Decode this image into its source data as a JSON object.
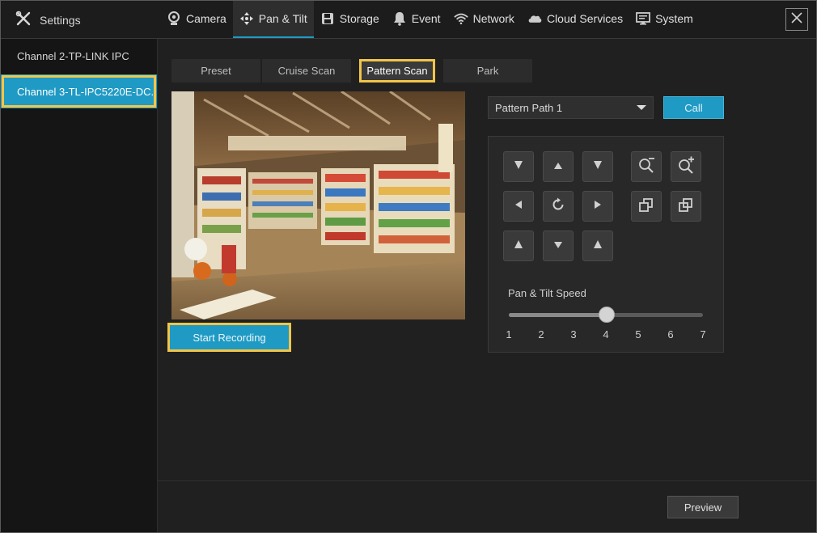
{
  "app": {
    "title": "Settings",
    "icon": "tools-icon"
  },
  "nav": [
    {
      "label": "Camera",
      "icon": "camera-icon",
      "active": false
    },
    {
      "label": "Pan & Tilt",
      "icon": "pan-tilt-icon",
      "active": true
    },
    {
      "label": "Storage",
      "icon": "storage-icon",
      "active": false
    },
    {
      "label": "Event",
      "icon": "bell-icon",
      "active": false
    },
    {
      "label": "Network",
      "icon": "wifi-icon",
      "active": false
    },
    {
      "label": "Cloud Services",
      "icon": "cloud-icon",
      "active": false
    },
    {
      "label": "System",
      "icon": "monitor-icon",
      "active": false
    }
  ],
  "sidebar": {
    "items": [
      {
        "label": "Channel 2-TP-LINK IPC",
        "active": false
      },
      {
        "label": "Channel 3-TL-IPC5220E-DC...",
        "active": true
      }
    ]
  },
  "tabs": [
    {
      "label": "Preset",
      "active": false
    },
    {
      "label": "Cruise Scan",
      "active": false
    },
    {
      "label": "Pattern Scan",
      "active": true
    },
    {
      "label": "Park",
      "active": false
    }
  ],
  "recording": {
    "start_label": "Start Recording"
  },
  "pattern": {
    "selected": "Pattern Path 1",
    "call_label": "Call"
  },
  "ptz": {
    "speed_label": "Pan & Tilt Speed",
    "speed_ticks": [
      "1",
      "2",
      "3",
      "4",
      "5",
      "6",
      "7"
    ],
    "speed_value": 4,
    "speed_min": 1,
    "speed_max": 7
  },
  "footer": {
    "preview_label": "Preview"
  },
  "colors": {
    "accent": "#1f9ac4",
    "highlight": "#f2c548"
  }
}
